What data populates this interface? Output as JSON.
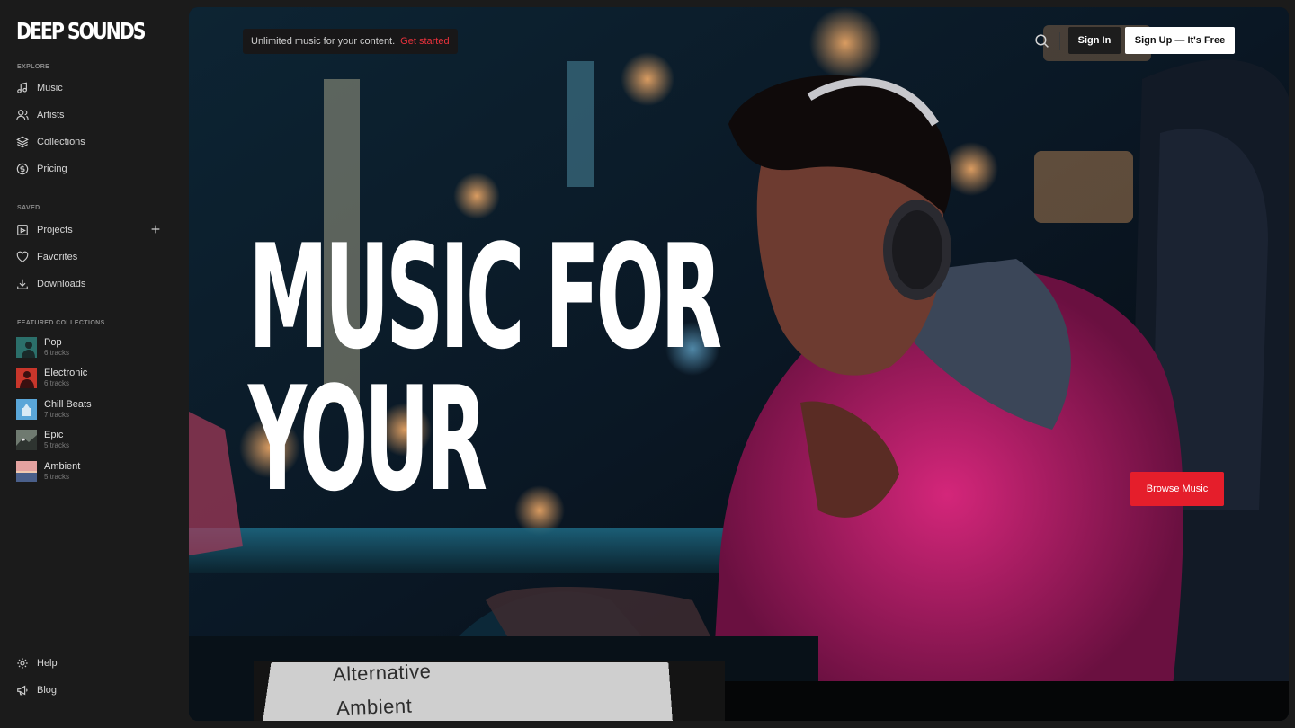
{
  "brand": {
    "logo": "DEEP SOUNDS"
  },
  "sidebar": {
    "explore_label": "EXPLORE",
    "explore": [
      {
        "label": "Music",
        "icon": "music-note-icon"
      },
      {
        "label": "Artists",
        "icon": "users-icon"
      },
      {
        "label": "Collections",
        "icon": "layers-icon"
      },
      {
        "label": "Pricing",
        "icon": "dollar-circle-icon"
      }
    ],
    "saved_label": "SAVED",
    "saved": [
      {
        "label": "Projects",
        "icon": "folder-icon"
      },
      {
        "label": "Favorites",
        "icon": "heart-icon"
      },
      {
        "label": "Downloads",
        "icon": "download-icon"
      }
    ],
    "featured_label": "FEATURED COLLECTIONS",
    "featured": [
      {
        "name": "Pop",
        "count": "6 tracks",
        "color": "#2b6f6a"
      },
      {
        "name": "Electronic",
        "count": "6 tracks",
        "color": "#c8362b"
      },
      {
        "name": "Chill Beats",
        "count": "7 tracks",
        "color": "#5aa6d8"
      },
      {
        "name": "Epic",
        "count": "5 tracks",
        "color": "#6f7a70"
      },
      {
        "name": "Ambient",
        "count": "5 tracks",
        "color": "#e4a2a0"
      }
    ],
    "footer": [
      {
        "label": "Help",
        "icon": "gear-icon"
      },
      {
        "label": "Blog",
        "icon": "megaphone-icon"
      }
    ]
  },
  "header": {
    "promo_text": "Unlimited music for your content.",
    "promo_link": "Get started",
    "sign_in": "Sign In",
    "sign_up": "Sign Up — It's Free"
  },
  "hero": {
    "headline_line1": "MUSIC FOR",
    "headline_line2": "YOUR",
    "browse_button": "Browse Music",
    "genres": [
      "Alternative",
      "Ambient"
    ]
  },
  "colors": {
    "accent": "#e51e2b",
    "background": "#1b1b1b"
  }
}
